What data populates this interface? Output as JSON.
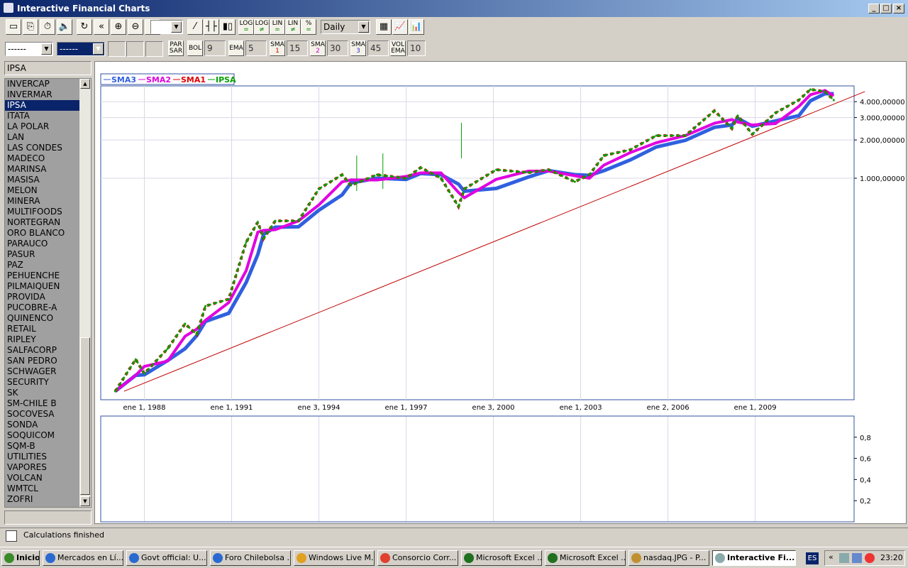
{
  "window": {
    "title": "Interactive Financial Charts",
    "controls": [
      "_",
      "□",
      "×"
    ]
  },
  "toolbar1": {
    "buttons": [
      "▭",
      "⎘",
      "⏱",
      "🔈",
      "↻",
      "«",
      "⊕",
      "⊖",
      "»"
    ],
    "empty_combo": "",
    "chart_types": [
      "⁄",
      "┤├",
      "▮▯"
    ],
    "scale_buttons": [
      [
        "LOG",
        "="
      ],
      [
        "LOG",
        "≠"
      ],
      [
        "LIN",
        "="
      ],
      [
        "LIN",
        "≠"
      ],
      [
        "%",
        "="
      ]
    ],
    "period": "Daily",
    "view_buttons": [
      "▦",
      "📈",
      "📊"
    ]
  },
  "toolbar2": {
    "combo1": "------",
    "combo2": "------",
    "indicators": [
      {
        "label": [
          "PAR",
          "SAR"
        ],
        "value": ""
      },
      {
        "label": [
          "BOL",
          ""
        ],
        "value": "9"
      },
      {
        "label": [
          "EMA",
          ""
        ],
        "value": "5"
      },
      {
        "label": [
          "SMA",
          "1"
        ],
        "value": "15"
      },
      {
        "label": [
          "SMA",
          "2"
        ],
        "value": "30"
      },
      {
        "label": [
          "SMA",
          "3"
        ],
        "value": "45"
      },
      {
        "label": [
          "VOL",
          "EMA"
        ],
        "value": "10"
      }
    ]
  },
  "sidebar": {
    "selected": "IPSA",
    "items": [
      "INVERCAP",
      "INVERMAR",
      "IPSA",
      "ITATA",
      "LA POLAR",
      "LAN",
      "LAS CONDES",
      "MADECO",
      "MARINSA",
      "MASISA",
      "MELON",
      "MINERA",
      "MULTIFOODS",
      "NORTEGRAN",
      "ORO BLANCO",
      "PARAUCO",
      "PASUR",
      "PAZ",
      "PEHUENCHE",
      "PILMAIQUEN",
      "PROVIDA",
      "PUCOBRE-A",
      "QUINENCO",
      "RETAIL",
      "RIPLEY",
      "SALFACORP",
      "SAN PEDRO",
      "SCHWAGER",
      "SECURITY",
      "SK",
      "SM-CHILE B",
      "SOCOVESA",
      "SONDA",
      "SOQUICOM",
      "SQM-B",
      "UTILITIES",
      "VAPORES",
      "VOLCAN",
      "WMTCL",
      "ZOFRI"
    ]
  },
  "status": {
    "text": "Calculations finished"
  },
  "taskbar": {
    "start": "Inicio",
    "tasks": [
      "Mercados en Lí...",
      "Govt official: U...",
      "Foro Chilebolsa ...",
      "Windows Live M...",
      "Consorcio Corr...",
      "Microsoft Excel ...",
      "Microsoft Excel ...",
      "nasdaq.JPG - P...",
      "Interactive Fi..."
    ],
    "lang": "ES",
    "clock": "23:20"
  },
  "colors": {
    "ipsa": "#00a000",
    "sma1": "#e00000",
    "sma2": "#e000e0",
    "sma3": "#3060e0",
    "trend": "#c00000"
  },
  "chart_data": [
    {
      "type": "line",
      "scale": "log",
      "title": "",
      "legend": [
        "SMA3",
        "SMA2",
        "SMA1",
        "IPSA"
      ],
      "legend_placement": "top-left",
      "xlim": [
        1986.5,
        2012.4
      ],
      "ylim": [
        18100,
        5323000
      ],
      "xticks": [
        {
          "x": 1988.0,
          "label": "ene 1, 1988"
        },
        {
          "x": 1991.0,
          "label": "ene 1, 1991"
        },
        {
          "x": 1994.0,
          "label": "ene 3, 1994"
        },
        {
          "x": 1997.0,
          "label": "ene 1, 1997"
        },
        {
          "x": 2000.0,
          "label": "ene 3, 2000"
        },
        {
          "x": 2003.0,
          "label": "ene 1, 2003"
        },
        {
          "x": 2006.0,
          "label": "ene 2, 2006"
        },
        {
          "x": 2009.0,
          "label": "ene 1, 2009"
        }
      ],
      "yticks": [
        {
          "y": 1000000,
          "label": "1.000,00000"
        },
        {
          "y": 2000000,
          "label": "2.000,00000"
        },
        {
          "y": 3000000,
          "label": "3.000,00000"
        },
        {
          "y": 4000000,
          "label": "4.000,00000"
        }
      ],
      "series": [
        {
          "name": "IPSA",
          "x": [
            1987.0,
            1987.7,
            1988.0,
            1988.8,
            1989.4,
            1989.8,
            1990.1,
            1990.9,
            1991.5,
            1991.9,
            1992.1,
            1992.5,
            1993.3,
            1994.0,
            1994.8,
            1995.1,
            1996.0,
            1997.0,
            1997.5,
            1998.2,
            1998.8,
            1999.0,
            2000.1,
            2001.2,
            2001.9,
            2002.8,
            2003.3,
            2003.8,
            2004.7,
            2005.6,
            2006.6,
            2007.6,
            2008.2,
            2008.4,
            2008.9,
            2009.7,
            2010.5,
            2010.9,
            2011.4,
            2011.7
          ],
          "y": [
            21100,
            37600,
            29100,
            45600,
            71600,
            59000,
            98700,
            112000,
            314000,
            451000,
            335000,
            462000,
            462000,
            824000,
            1066000,
            879000,
            1066000,
            1000000,
            1213000,
            1000000,
            598000,
            824000,
            1167000,
            1108000,
            1167000,
            938000,
            1066000,
            1509000,
            1672000,
            2164000,
            2164000,
            3395000,
            2461000,
            3102000,
            2219000,
            3266000,
            4120000,
            4993000,
            4806000,
            4120000
          ]
        }
      ],
      "spikes": [
        {
          "x": 1995.3,
          "high": 1509000
        },
        {
          "x": 1996.2,
          "high": 1568000
        },
        {
          "x": 1998.9,
          "high": 2729000
        }
      ],
      "trendline": {
        "x": [
          1987.3,
          2012.6
        ],
        "y": [
          21100,
          4806000
        ]
      }
    },
    {
      "type": "line",
      "title": "lower panel",
      "ylim": [
        0,
        1.0
      ],
      "yticks": [
        {
          "y": 0.8,
          "label": "0,8"
        },
        {
          "y": 0.6,
          "label": "0,6"
        },
        {
          "y": 0.4,
          "label": "0,4"
        },
        {
          "y": 0.2,
          "label": "0,2"
        }
      ]
    }
  ]
}
